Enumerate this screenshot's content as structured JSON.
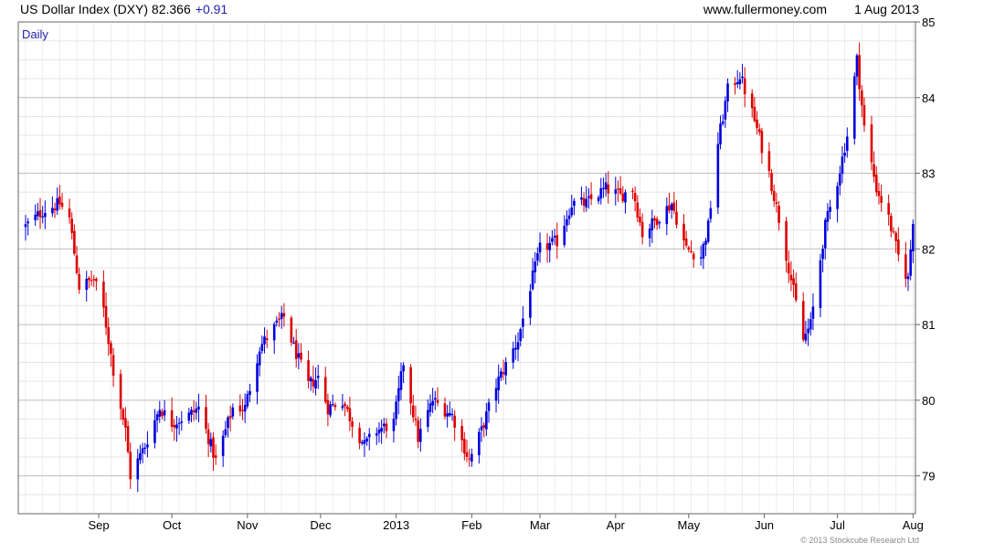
{
  "header": {
    "title": "US Dollar Index (DXY) 82.366",
    "change": "+0.91",
    "site": "www.fullermoney.com",
    "date": "1 Aug 2013"
  },
  "panel_label": "Daily",
  "copyright": "© 2013 Stockcube Research Ltd",
  "colors": {
    "up": "#0000dd",
    "down": "#dd0000",
    "grid": "#d0d0d0",
    "axis": "#666666",
    "text": "#000000",
    "label_blue": "#2222aa"
  },
  "chart_data": {
    "type": "candlestick",
    "title": "US Dollar Index (DXY)",
    "last": 82.366,
    "change": 0.91,
    "ylim": [
      78.5,
      85.0
    ],
    "y_ticks": [
      79,
      80,
      81,
      82,
      83,
      84,
      85
    ],
    "x_tick_labels": [
      "Sep",
      "Oct",
      "Nov",
      "Dec",
      "2013",
      "Feb",
      "Mar",
      "Apr",
      "May",
      "Jun",
      "Jul",
      "Aug"
    ],
    "grid": true,
    "y_axis_side": "right",
    "close_path": [
      [
        "2012-08-02",
        82.3
      ],
      [
        "2012-08-09",
        82.5
      ],
      [
        "2012-08-16",
        82.6
      ],
      [
        "2012-08-20",
        82.4
      ],
      [
        "2012-08-24",
        81.5
      ],
      [
        "2012-08-30",
        81.6
      ],
      [
        "2012-09-03",
        81.2
      ],
      [
        "2012-09-07",
        80.4
      ],
      [
        "2012-09-12",
        79.6
      ],
      [
        "2012-09-14",
        79.0
      ],
      [
        "2012-09-20",
        79.4
      ],
      [
        "2012-09-26",
        79.9
      ],
      [
        "2012-10-01",
        79.7
      ],
      [
        "2012-10-08",
        79.8
      ],
      [
        "2012-10-12",
        79.9
      ],
      [
        "2012-10-19",
        79.2
      ],
      [
        "2012-10-26",
        79.9
      ],
      [
        "2012-10-31",
        79.9
      ],
      [
        "2012-11-06",
        80.7
      ],
      [
        "2012-11-13",
        81.0
      ],
      [
        "2012-11-16",
        81.1
      ],
      [
        "2012-11-20",
        80.7
      ],
      [
        "2012-11-26",
        80.2
      ],
      [
        "2012-11-30",
        80.3
      ],
      [
        "2012-12-04",
        79.9
      ],
      [
        "2012-12-10",
        80.0
      ],
      [
        "2012-12-14",
        79.7
      ],
      [
        "2012-12-19",
        79.4
      ],
      [
        "2012-12-24",
        79.6
      ],
      [
        "2012-12-31",
        79.7
      ],
      [
        "2013-01-04",
        80.5
      ],
      [
        "2013-01-10",
        79.5
      ],
      [
        "2013-01-16",
        80.0
      ],
      [
        "2013-01-24",
        79.8
      ],
      [
        "2013-01-31",
        79.2
      ],
      [
        "2013-02-05",
        79.6
      ],
      [
        "2013-02-11",
        80.2
      ],
      [
        "2013-02-20",
        80.8
      ],
      [
        "2013-02-25",
        81.5
      ],
      [
        "2013-03-01",
        82.0
      ],
      [
        "2013-03-08",
        82.1
      ],
      [
        "2013-03-14",
        82.6
      ],
      [
        "2013-03-20",
        82.6
      ],
      [
        "2013-03-28",
        82.8
      ],
      [
        "2013-04-03",
        82.7
      ],
      [
        "2013-04-08",
        82.8
      ],
      [
        "2013-04-12",
        82.2
      ],
      [
        "2013-04-18",
        82.4
      ],
      [
        "2013-04-24",
        82.6
      ],
      [
        "2013-04-30",
        82.0
      ],
      [
        "2013-05-06",
        81.9
      ],
      [
        "2013-05-09",
        82.3
      ],
      [
        "2013-05-13",
        83.4
      ],
      [
        "2013-05-17",
        84.1
      ],
      [
        "2013-05-22",
        84.3
      ],
      [
        "2013-05-28",
        83.7
      ],
      [
        "2013-06-03",
        83.0
      ],
      [
        "2013-06-07",
        82.4
      ],
      [
        "2013-06-12",
        81.6
      ],
      [
        "2013-06-17",
        80.8
      ],
      [
        "2013-06-20",
        81.0
      ],
      [
        "2013-06-26",
        82.3
      ],
      [
        "2013-07-01",
        82.9
      ],
      [
        "2013-07-05",
        83.5
      ],
      [
        "2013-07-09",
        84.5
      ],
      [
        "2013-07-12",
        83.6
      ],
      [
        "2013-07-17",
        82.8
      ],
      [
        "2013-07-22",
        82.4
      ],
      [
        "2013-07-26",
        81.9
      ],
      [
        "2013-07-30",
        81.6
      ],
      [
        "2013-08-01",
        82.4
      ]
    ]
  }
}
